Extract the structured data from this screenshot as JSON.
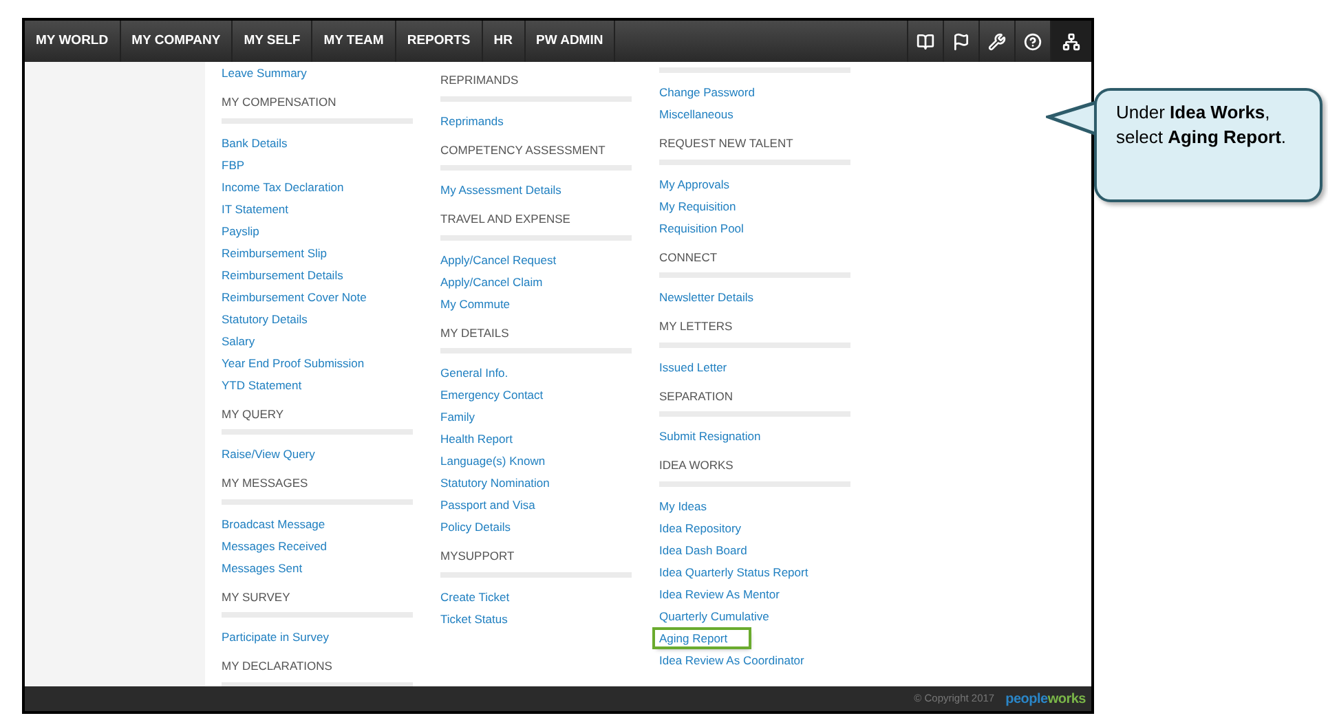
{
  "nav": {
    "items": [
      "MY WORLD",
      "MY COMPANY",
      "MY SELF",
      "MY TEAM",
      "REPORTS",
      "HR",
      "PW ADMIN"
    ]
  },
  "menu_columns": [
    {
      "sections": [
        {
          "links": [
            {
              "label": "Leave Summary",
              "highlighted": false
            }
          ]
        },
        {
          "heading": "MY COMPENSATION",
          "links": [
            {
              "label": "Bank Details",
              "highlighted": false
            },
            {
              "label": "FBP",
              "highlighted": false
            },
            {
              "label": "Income Tax Declaration",
              "highlighted": false
            },
            {
              "label": "IT Statement",
              "highlighted": false
            },
            {
              "label": "Payslip",
              "highlighted": false
            },
            {
              "label": "Reimbursement Slip",
              "highlighted": false
            },
            {
              "label": "Reimbursement Details",
              "highlighted": false
            },
            {
              "label": "Reimbursement Cover Note",
              "highlighted": false
            },
            {
              "label": "Statutory Details",
              "highlighted": false
            },
            {
              "label": "Salary",
              "highlighted": false
            },
            {
              "label": "Year End Proof Submission",
              "highlighted": false
            },
            {
              "label": "YTD Statement",
              "highlighted": false
            }
          ]
        },
        {
          "heading": "MY QUERY",
          "links": [
            {
              "label": "Raise/View Query",
              "highlighted": false
            }
          ]
        },
        {
          "heading": "MY MESSAGES",
          "links": [
            {
              "label": "Broadcast Message",
              "highlighted": false
            },
            {
              "label": "Messages Received",
              "highlighted": false
            },
            {
              "label": "Messages Sent",
              "highlighted": false
            }
          ]
        },
        {
          "heading": "MY SURVEY",
          "links": [
            {
              "label": "Participate in Survey",
              "highlighted": false
            }
          ]
        },
        {
          "heading": "MY DECLARATIONS"
        }
      ]
    },
    {
      "sections": [
        {
          "heading": "REPRIMANDS",
          "links": [
            {
              "label": "Reprimands",
              "highlighted": false
            }
          ]
        },
        {
          "heading": "COMPETENCY ASSESSMENT",
          "links": [
            {
              "label": "My Assessment Details",
              "highlighted": false
            }
          ]
        },
        {
          "heading": "TRAVEL AND EXPENSE",
          "links": [
            {
              "label": "Apply/Cancel Request",
              "highlighted": false
            },
            {
              "label": "Apply/Cancel Claim",
              "highlighted": false
            },
            {
              "label": "My Commute",
              "highlighted": false
            }
          ]
        },
        {
          "heading": "MY DETAILS",
          "links": [
            {
              "label": "General Info.",
              "highlighted": false
            },
            {
              "label": "Emergency Contact",
              "highlighted": false
            },
            {
              "label": "Family",
              "highlighted": false
            },
            {
              "label": "Health Report",
              "highlighted": false
            },
            {
              "label": "Language(s) Known",
              "highlighted": false
            },
            {
              "label": "Statutory Nomination",
              "highlighted": false
            },
            {
              "label": "Passport and Visa",
              "highlighted": false
            },
            {
              "label": "Policy Details",
              "highlighted": false
            }
          ]
        },
        {
          "heading": "MYSUPPORT",
          "links": [
            {
              "label": "Create Ticket",
              "highlighted": false
            },
            {
              "label": "Ticket Status",
              "highlighted": false
            }
          ]
        }
      ]
    },
    {
      "sections": [
        {
          "separator_only": true,
          "links": [
            {
              "label": "Change Password",
              "highlighted": false
            },
            {
              "label": "Miscellaneous",
              "highlighted": false
            }
          ]
        },
        {
          "heading": "REQUEST NEW TALENT",
          "links": [
            {
              "label": "My Approvals",
              "highlighted": false
            },
            {
              "label": "My Requisition",
              "highlighted": false
            },
            {
              "label": "Requisition Pool",
              "highlighted": false
            }
          ]
        },
        {
          "heading": "CONNECT",
          "links": [
            {
              "label": "Newsletter Details",
              "highlighted": false
            }
          ]
        },
        {
          "heading": "MY LETTERS",
          "links": [
            {
              "label": "Issued Letter",
              "highlighted": false
            }
          ]
        },
        {
          "heading": "SEPARATION",
          "links": [
            {
              "label": "Submit Resignation",
              "highlighted": false
            }
          ]
        },
        {
          "heading": "IDEA WORKS",
          "links": [
            {
              "label": "My Ideas",
              "highlighted": false
            },
            {
              "label": "Idea Repository",
              "highlighted": false
            },
            {
              "label": "Idea Dash Board",
              "highlighted": false
            },
            {
              "label": "Idea Quarterly Status Report",
              "highlighted": false
            },
            {
              "label": "Idea Review As Mentor",
              "highlighted": false
            },
            {
              "label": "Quarterly Cumulative",
              "highlighted": false
            },
            {
              "label": "Aging Report",
              "highlighted": true
            },
            {
              "label": "Idea Review As Coordinator",
              "highlighted": false
            }
          ]
        }
      ]
    }
  ],
  "footer": {
    "copyright": "© Copyright 2017",
    "logo": [
      "people",
      "works"
    ]
  },
  "callout": {
    "text": "Under **Idea Works**, select **Aging Report**."
  }
}
